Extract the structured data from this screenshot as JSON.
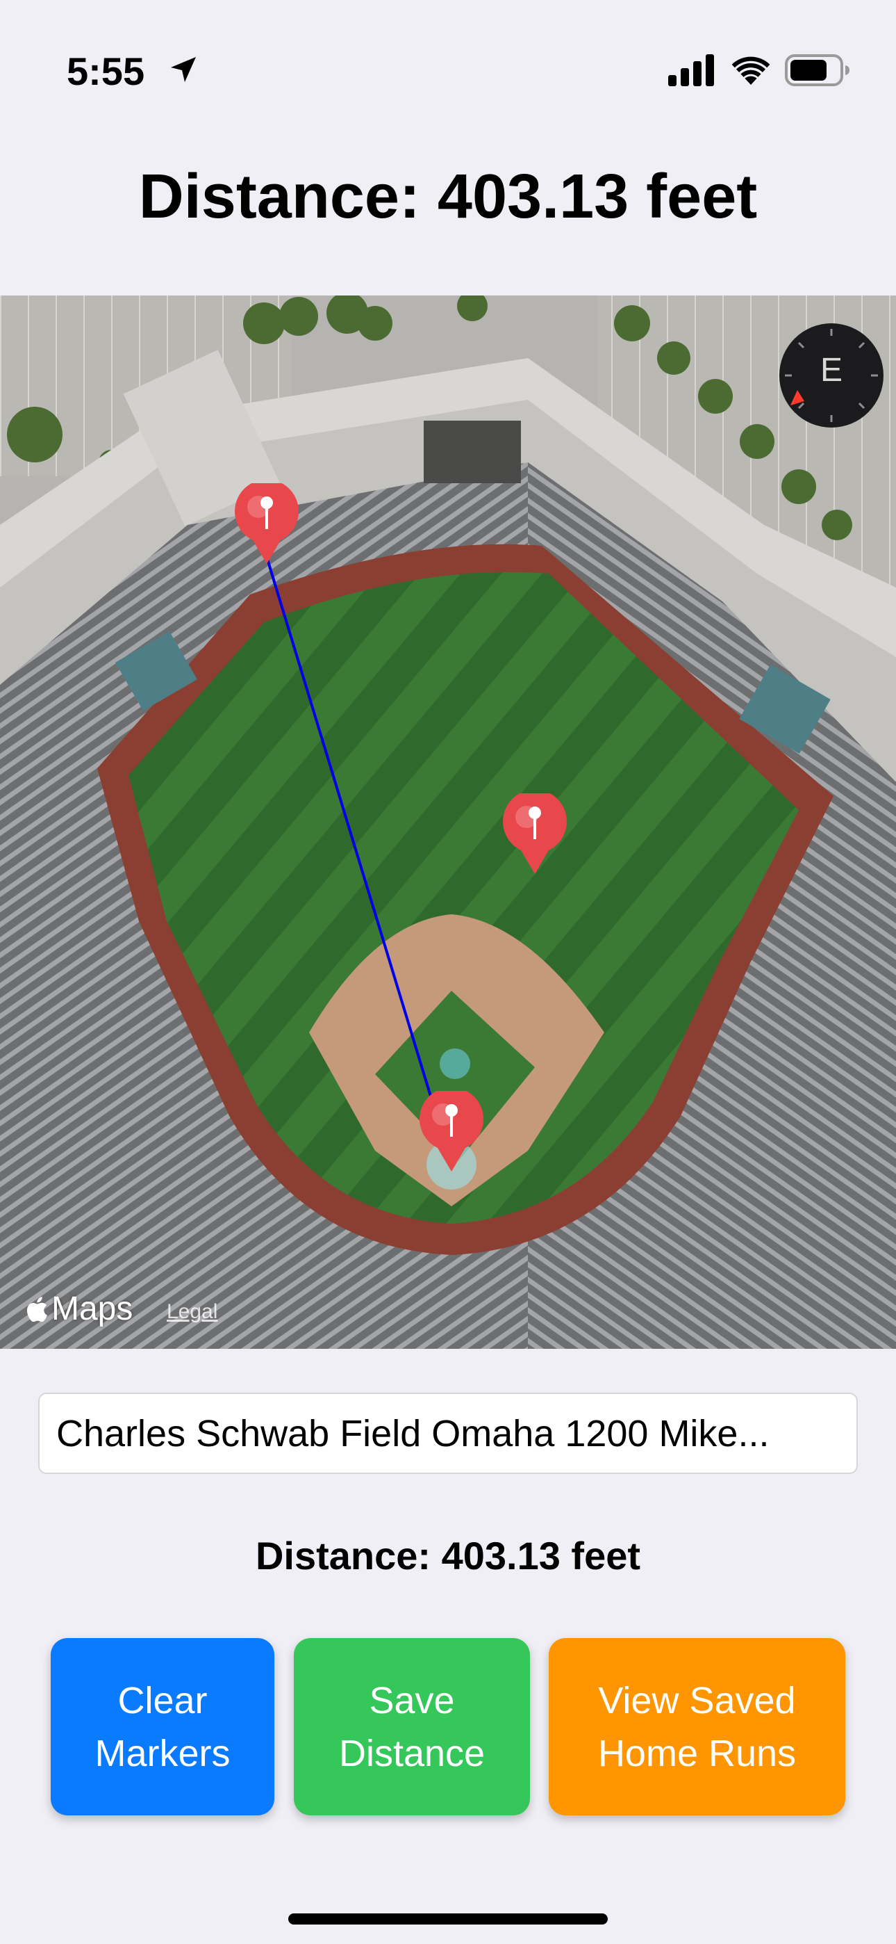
{
  "status_bar": {
    "time": "5:55",
    "icons": [
      "location-arrow-icon",
      "cellular-signal-icon",
      "wifi-icon",
      "battery-icon"
    ]
  },
  "title": "Distance: 403.13 feet",
  "map": {
    "compass_label": "E",
    "attribution": "Maps",
    "legal": "Legal",
    "colors": {
      "line": "#0000e6",
      "pin": "#e8474b",
      "grass": "#2f6b2c",
      "infield": "#c59a7a",
      "warning_track": "#8b3f32"
    },
    "pins": [
      "pin-home-plate",
      "pin-left-field",
      "pin-center-field"
    ]
  },
  "address": {
    "value": "Charles Schwab Field Omaha 1200 Mike..."
  },
  "distance_text": "Distance: 403.13 feet",
  "buttons": {
    "clear": "Clear\nMarkers",
    "save": "Save\nDistance",
    "view": "View Saved\nHome Runs"
  },
  "colors": {
    "clear": "#0a7aff",
    "save": "#35c759",
    "view": "#ff9500",
    "background": "#f0eff5"
  }
}
